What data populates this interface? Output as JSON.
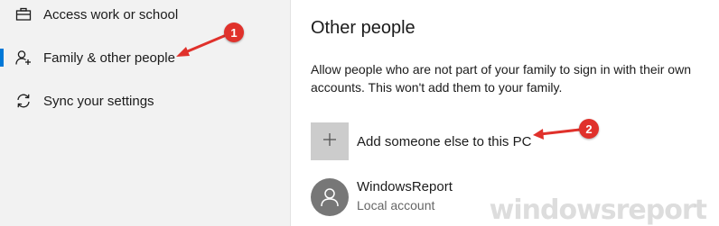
{
  "sidebar": {
    "items": [
      {
        "label": "Access work or school",
        "icon": "briefcase-icon"
      },
      {
        "label": "Family & other people",
        "icon": "person-add-icon",
        "active": true
      },
      {
        "label": "Sync your settings",
        "icon": "sync-icon"
      }
    ]
  },
  "main": {
    "title": "Other people",
    "description": "Allow people who are not part of your family to sign in with their own accounts. This won't add them to your family.",
    "add_label": "Add someone else to this PC",
    "account": {
      "name": "WindowsReport",
      "type": "Local account"
    }
  },
  "annotations": [
    {
      "number": "1"
    },
    {
      "number": "2"
    }
  ],
  "watermark": "windowsreport",
  "colors": {
    "accent": "#0078d7",
    "annotation": "#e0312b",
    "sidebar_bg": "#f2f2f2",
    "tile_bg": "#cccccc"
  }
}
